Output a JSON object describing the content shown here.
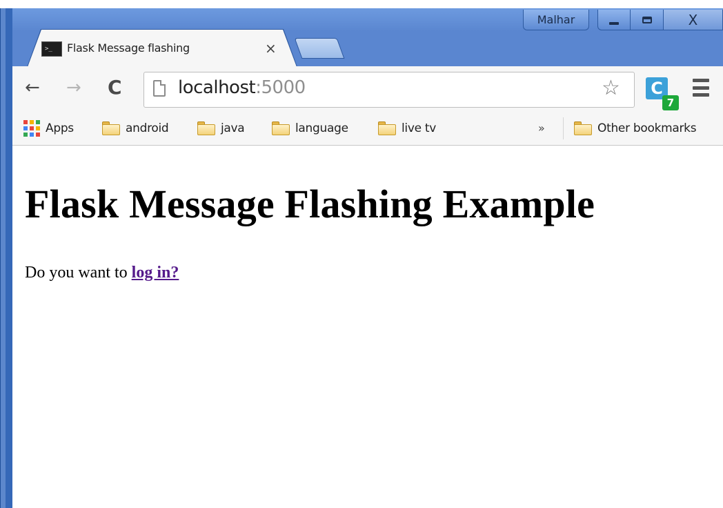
{
  "window": {
    "profile_name": "Malhar",
    "controls": {
      "minimize": "",
      "maximize": "",
      "close": "X"
    }
  },
  "tab": {
    "title": "Flask Message flashing",
    "close_glyph": "×",
    "favicon_glyph": ">_"
  },
  "toolbar": {
    "back_glyph": "←",
    "forward_glyph": "→",
    "reload_glyph": "C",
    "url_host": "localhost",
    "url_port": ":5000",
    "star_glyph": "☆",
    "extension_letter": "C",
    "extension_badge": "7"
  },
  "bookmarks": {
    "apps_label": "Apps",
    "items": [
      {
        "label": "android"
      },
      {
        "label": "java"
      },
      {
        "label": "language"
      },
      {
        "label": "live tv"
      }
    ],
    "overflow_glyph": "»",
    "other_label": "Other bookmarks"
  },
  "page": {
    "heading": "Flask Message Flashing Example",
    "prompt_text": "Do you want to ",
    "login_link": "log in?"
  },
  "colors": {
    "link_visited": "#551a8b",
    "chrome_frame": "#5a86d0",
    "toolbar_bg": "#f6f6f6"
  }
}
